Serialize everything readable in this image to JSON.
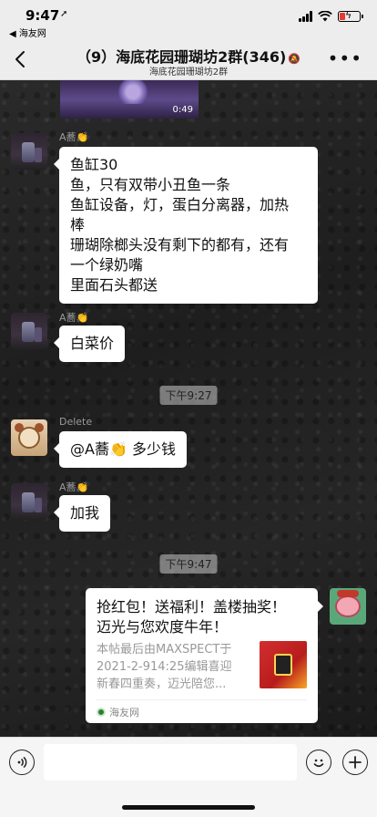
{
  "status_bar": {
    "time": "9:47",
    "back_app": "◀ 海友网",
    "battery_color": "#e53935"
  },
  "nav": {
    "title": "（9）海底花园珊瑚坊2群(346)",
    "subtitle": "海底花园珊瑚坊2群",
    "more": "•••"
  },
  "video": {
    "duration": "0:49"
  },
  "messages": [
    {
      "sender": "A蕎",
      "sender_emoji": "👏",
      "lines": [
        "鱼缸30",
        "鱼，只有双带小丑鱼一条",
        "鱼缸设备，灯，蛋白分离器，加热",
        "棒",
        "珊瑚除榔头没有剩下的都有，还有",
        "一个绿奶嘴",
        "里面石头都送"
      ]
    },
    {
      "sender": "A蕎",
      "sender_emoji": "👏",
      "text": "白菜价"
    },
    {
      "divider": "下午9:27"
    },
    {
      "sender": "Delete",
      "text_prefix": "@A蕎",
      "text_emoji": "👏",
      "text_suffix": "多少钱"
    },
    {
      "sender": "A蕎",
      "sender_emoji": "👏",
      "text": "加我"
    },
    {
      "divider": "下午9:47"
    }
  ],
  "link_card": {
    "title_line1": "抢红包！送福利！盖楼抽奖！",
    "title_line2": "迈光与您欢度牛年！",
    "desc_line1": "本帖最后由MAXSPECT于",
    "desc_line2": "2021-2-914:25编辑喜迎",
    "desc_line3": "新春四重奏，迈光陪您...",
    "source": "海友网"
  },
  "input_bar": {
    "voice_icon": "voice-icon",
    "emoji_icon": "emoji-icon",
    "plus_icon": "plus-icon"
  }
}
